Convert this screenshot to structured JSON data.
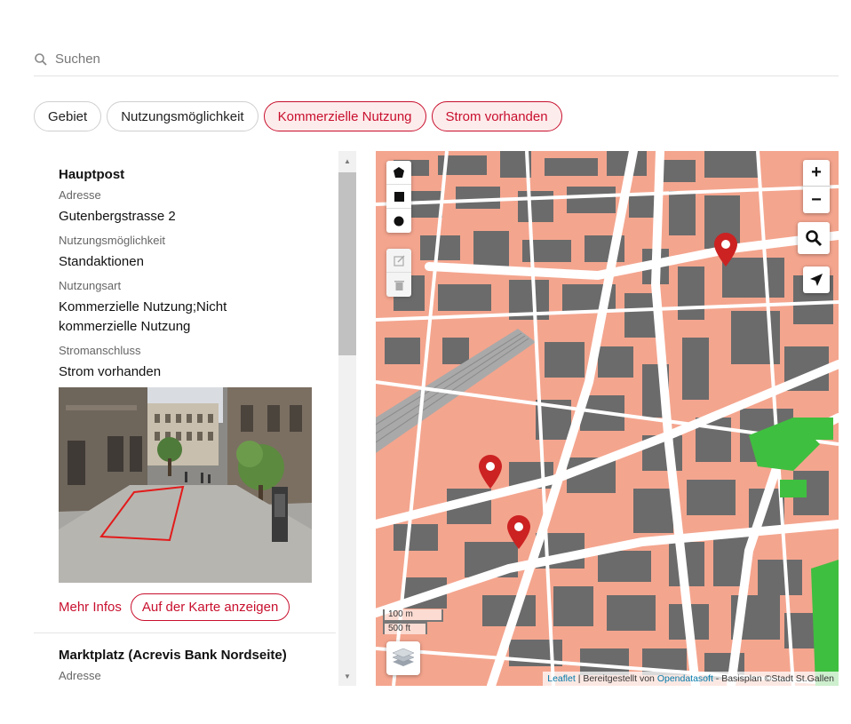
{
  "search": {
    "placeholder": "Suchen"
  },
  "filters": [
    {
      "label": "Gebiet",
      "active": false
    },
    {
      "label": "Nutzungsmöglichkeit",
      "active": false
    },
    {
      "label": "Kommerzielle Nutzung",
      "active": true
    },
    {
      "label": "Strom vorhanden",
      "active": true
    }
  ],
  "list": {
    "items": [
      {
        "title": "Hauptpost",
        "address_label": "Adresse",
        "address": "Gutenbergstrasse 2",
        "usage_label": "Nutzungsmöglichkeit",
        "usage": "Standaktionen",
        "type_label": "Nutzungsart",
        "type_line1": "Kommerzielle Nutzung;Nicht",
        "type_line2": "kommerzielle Nutzung",
        "power_label": "Stromanschluss",
        "power": "Strom vorhanden",
        "more_label": "Mehr Infos",
        "show_on_map_label": "Auf der Karte anzeigen"
      },
      {
        "title": "Marktplatz (Acrevis Bank Nordseite)",
        "address_label": "Adresse"
      }
    ]
  },
  "map": {
    "zoom_in": "+",
    "zoom_out": "−",
    "scale_metric": "100 m",
    "scale_imperial": "500 ft",
    "attribution": {
      "leaflet": "Leaflet",
      "sep": " | Bereitgestellt von ",
      "provider": "Opendatasoft",
      "rest": " - Basisplan ©Stadt St.Gallen"
    },
    "marker_count": 3,
    "colors": {
      "buildings": "#6b6b6b",
      "land": "#f4a58e",
      "roads": "#ffffff",
      "park": "#3fbf3f",
      "marker": "#cc2222"
    }
  },
  "accent": "#c8102e"
}
